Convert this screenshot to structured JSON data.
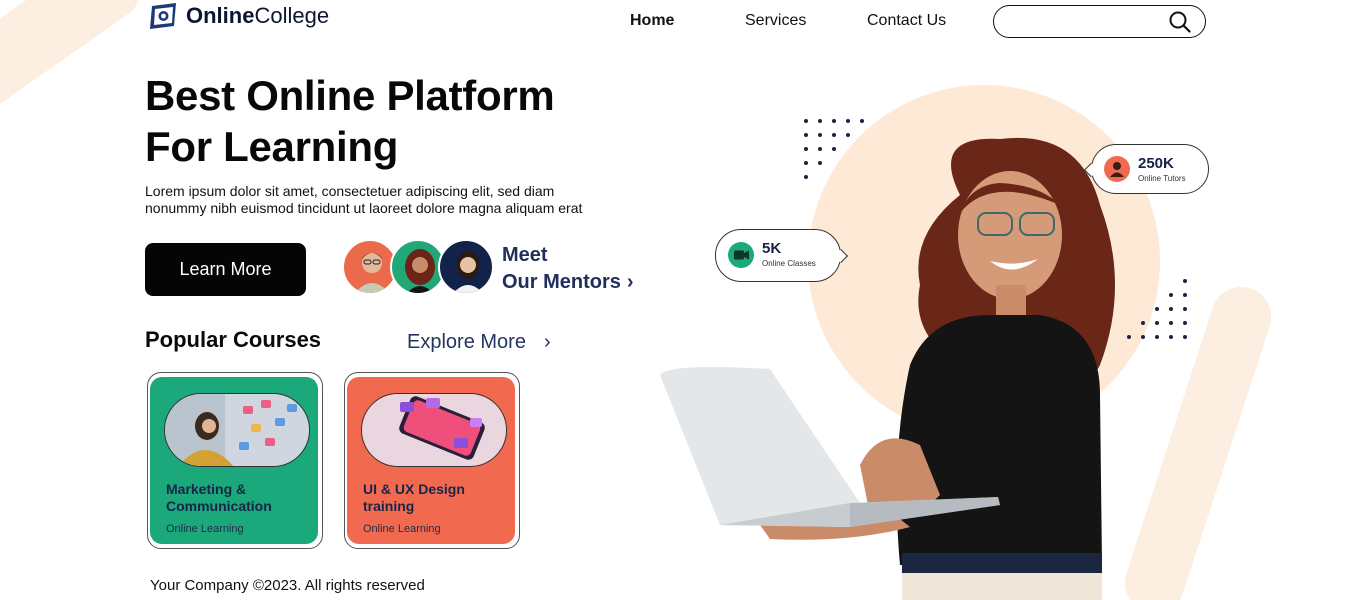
{
  "brand": {
    "name_bold": "Online",
    "name_regular": "College"
  },
  "nav": {
    "items": [
      {
        "label": "Home"
      },
      {
        "label": "Services"
      },
      {
        "label": "Contact Us"
      }
    ]
  },
  "search": {
    "placeholder": "",
    "icon": "search-icon"
  },
  "hero": {
    "title_line1": "Best Online Platform",
    "title_line2": "For Learning",
    "description_line1": "Lorem ipsum dolor sit amet, consectetuer adipiscing elit, sed diam",
    "description_line2": "nonummy nibh euismod tincidunt ut laoreet dolore magna aliquam erat",
    "cta_label": "Learn More"
  },
  "mentors": {
    "line1": "Meet",
    "line2": "Our Mentors",
    "chevron": "›"
  },
  "popular": {
    "title": "Popular Courses",
    "explore_label": "Explore More",
    "explore_chevron": "›",
    "courses": [
      {
        "title_line1": "Marketing &",
        "title_line2": "Communication",
        "subtitle": "Online Learning",
        "color": "#1ba87a"
      },
      {
        "title_line1": "UI & UX Design",
        "title_line2": "training",
        "subtitle": "Online Learning",
        "color": "#f16a50"
      }
    ]
  },
  "stats": [
    {
      "value": "5K",
      "label": "Online Classes",
      "icon": "video-icon"
    },
    {
      "value": "250K",
      "label": "Online Tutors",
      "icon": "user-icon"
    }
  ],
  "footer": {
    "text": "Your Company ©2023.  All rights reserved"
  },
  "colors": {
    "accent_green": "#1ba87a",
    "accent_orange": "#f16a50",
    "peach": "#fde9d6",
    "navy": "#1f2f5a"
  }
}
